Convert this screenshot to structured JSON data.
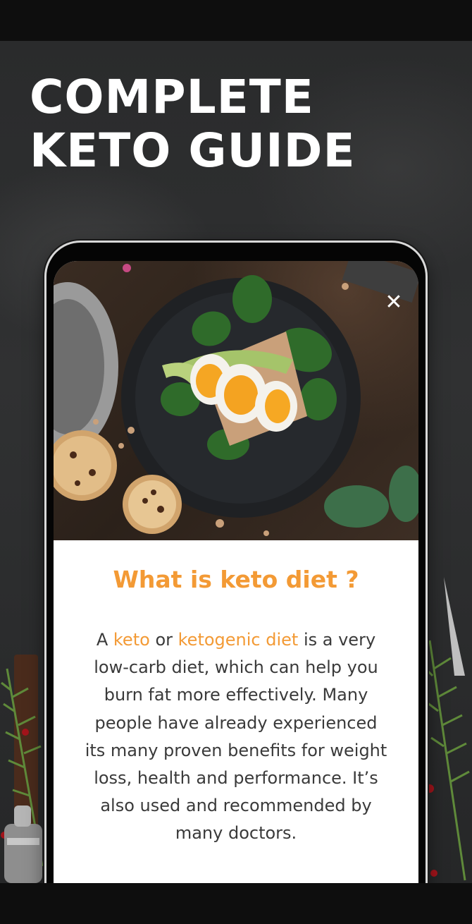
{
  "headline": {
    "line1": "COMPLETE",
    "line2": "KETO GUIDE"
  },
  "screen": {
    "photo_alt": "Avocado toast with boiled eggs and spinach",
    "close_icon": "close-icon",
    "title": "What is keto diet ?",
    "body": {
      "w1": "A",
      "keyword1": "keto",
      "w2": "or",
      "keyword2": "ketogenic diet",
      "rest": "is a very low-carb diet, which can help you burn fat more effectively. Many people have already experienced its many proven benefits for weight loss, health and performance. It’s also used and recommended by many doctors."
    }
  },
  "colors": {
    "accent": "#f39a35",
    "text": "#3a3a3a",
    "background": "#2d2e2f"
  }
}
